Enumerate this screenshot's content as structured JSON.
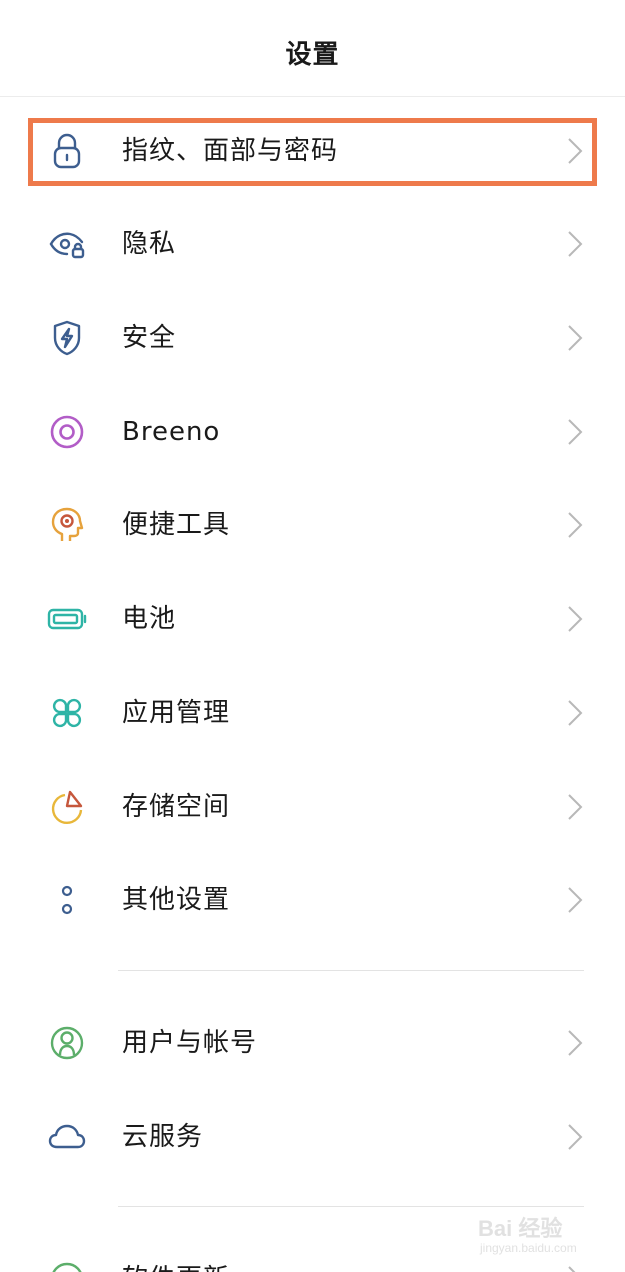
{
  "header": {
    "title": "设置"
  },
  "items": [
    {
      "label": "指纹、面部与密码",
      "icon": "lock-icon"
    },
    {
      "label": "隐私",
      "icon": "privacy-eye-icon"
    },
    {
      "label": "安全",
      "icon": "shield-icon"
    },
    {
      "label": "Breeno",
      "icon": "breeno-icon"
    },
    {
      "label": "便捷工具",
      "icon": "head-tools-icon"
    },
    {
      "label": "电池",
      "icon": "battery-icon"
    },
    {
      "label": "应用管理",
      "icon": "app-grid-icon"
    },
    {
      "label": "存储空间",
      "icon": "storage-pie-icon"
    },
    {
      "label": "其他设置",
      "icon": "more-dots-icon"
    },
    {
      "label": "用户与帐号",
      "icon": "user-icon"
    },
    {
      "label": "云服务",
      "icon": "cloud-icon"
    },
    {
      "label": "软件更新",
      "icon": "update-icon"
    }
  ],
  "watermark": {
    "main": "Bai 经验",
    "sub": "jingyan.baidu.com"
  },
  "colors": {
    "highlight_border": "#ee7a4b",
    "icon_blue": "#3d5e8f",
    "icon_purple": "#b25dc7",
    "icon_orange": "#e6a23c",
    "icon_teal": "#2eb4a6",
    "icon_yellow": "#e8b73a",
    "icon_green": "#5cae6a"
  }
}
